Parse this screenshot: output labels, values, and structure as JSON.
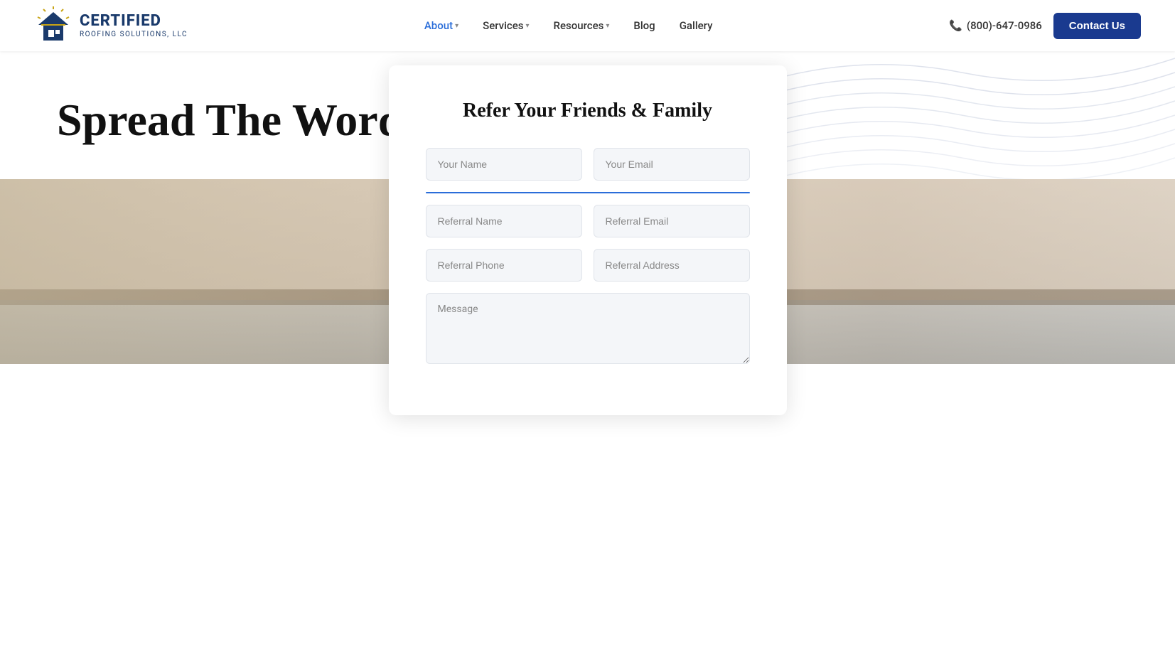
{
  "header": {
    "logo": {
      "certified": "CERTIFIED",
      "subtitle": "ROOFING SOLUTIONS, LLC"
    },
    "nav": {
      "items": [
        {
          "label": "About",
          "hasDropdown": true,
          "id": "about"
        },
        {
          "label": "Services",
          "hasDropdown": true,
          "id": "services"
        },
        {
          "label": "Resources",
          "hasDropdown": true,
          "id": "resources"
        },
        {
          "label": "Blog",
          "hasDropdown": false,
          "id": "blog"
        },
        {
          "label": "Gallery",
          "hasDropdown": false,
          "id": "gallery"
        }
      ]
    },
    "phone": {
      "icon": "📞",
      "number": "(800)-647-0986"
    },
    "contact_btn": "Contact Us"
  },
  "hero": {
    "title": "Spread The Word!"
  },
  "form": {
    "title": "Refer Your Friends & Family",
    "fields": {
      "your_name": "Your Name",
      "your_email": "Your Email",
      "referral_name": "Referral Name",
      "referral_email": "Referral Email",
      "referral_phone": "Referral Phone",
      "referral_address": "Referral Address",
      "message": "Message"
    }
  },
  "colors": {
    "primary": "#1a3a8f",
    "accent": "#2a6dd9",
    "divider": "#2a6dd9"
  }
}
